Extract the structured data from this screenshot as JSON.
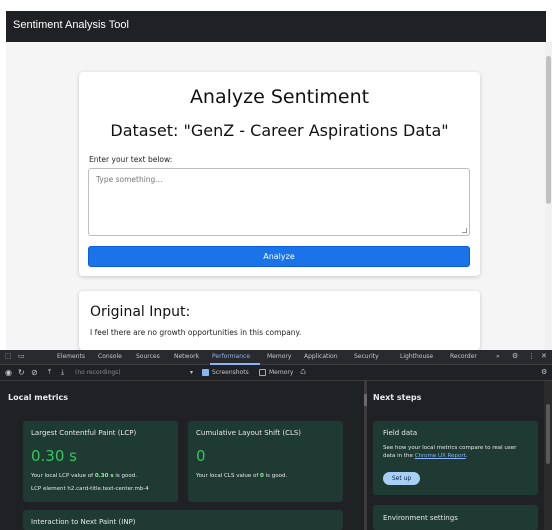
{
  "app": {
    "title": "Sentiment Analysis Tool"
  },
  "analyze_card": {
    "heading": "Analyze Sentiment",
    "dataset_title": "Dataset: \"GenZ - Career Aspirations Data\"",
    "input_label": "Enter your text below:",
    "input_placeholder": "Type something...",
    "button_label": "Analyze"
  },
  "original_card": {
    "heading": "Original Input:",
    "text": "I feel there are no growth opportunities in this company."
  },
  "devtools": {
    "tabs": [
      "Elements",
      "Console",
      "Sources",
      "Network",
      "Performance",
      "Memory",
      "Application",
      "Security",
      "Lighthouse",
      "Recorder"
    ],
    "active_tab": "Performance",
    "overflow": "»",
    "toolbar": {
      "recording": "(no recordings)",
      "screenshots": "Screenshots",
      "memory": "Memory"
    },
    "local_metrics": {
      "header": "Local metrics",
      "lcp": {
        "title": "Largest Contentful Paint (LCP)",
        "value": "0.30 s",
        "desc_prefix": "Your local LCP value of",
        "desc_value": "0.30 s",
        "desc_suffix": "is good.",
        "element_label": "LCP element",
        "element_value": "h2.card-title.text-center.mb-4"
      },
      "cls": {
        "title": "Cumulative Layout Shift (CLS)",
        "value": "0",
        "desc_prefix": "Your local CLS value of",
        "desc_value": "0",
        "desc_suffix": "is good."
      },
      "inp": {
        "title": "Interaction to Next Paint (INP)"
      }
    },
    "next_steps": {
      "header": "Next steps",
      "field_data": {
        "title": "Field data",
        "text_line1": "See how your local metrics compare to real user",
        "text_line2_prefix": "data in the",
        "link": "Chrome UX Report",
        "button": "Set up"
      },
      "env": {
        "title": "Environment settings"
      }
    }
  },
  "colors": {
    "accent": "#1a73e8",
    "good": "#34c759",
    "devtools_bg": "#202124",
    "card_bg": "#1e3a32"
  }
}
